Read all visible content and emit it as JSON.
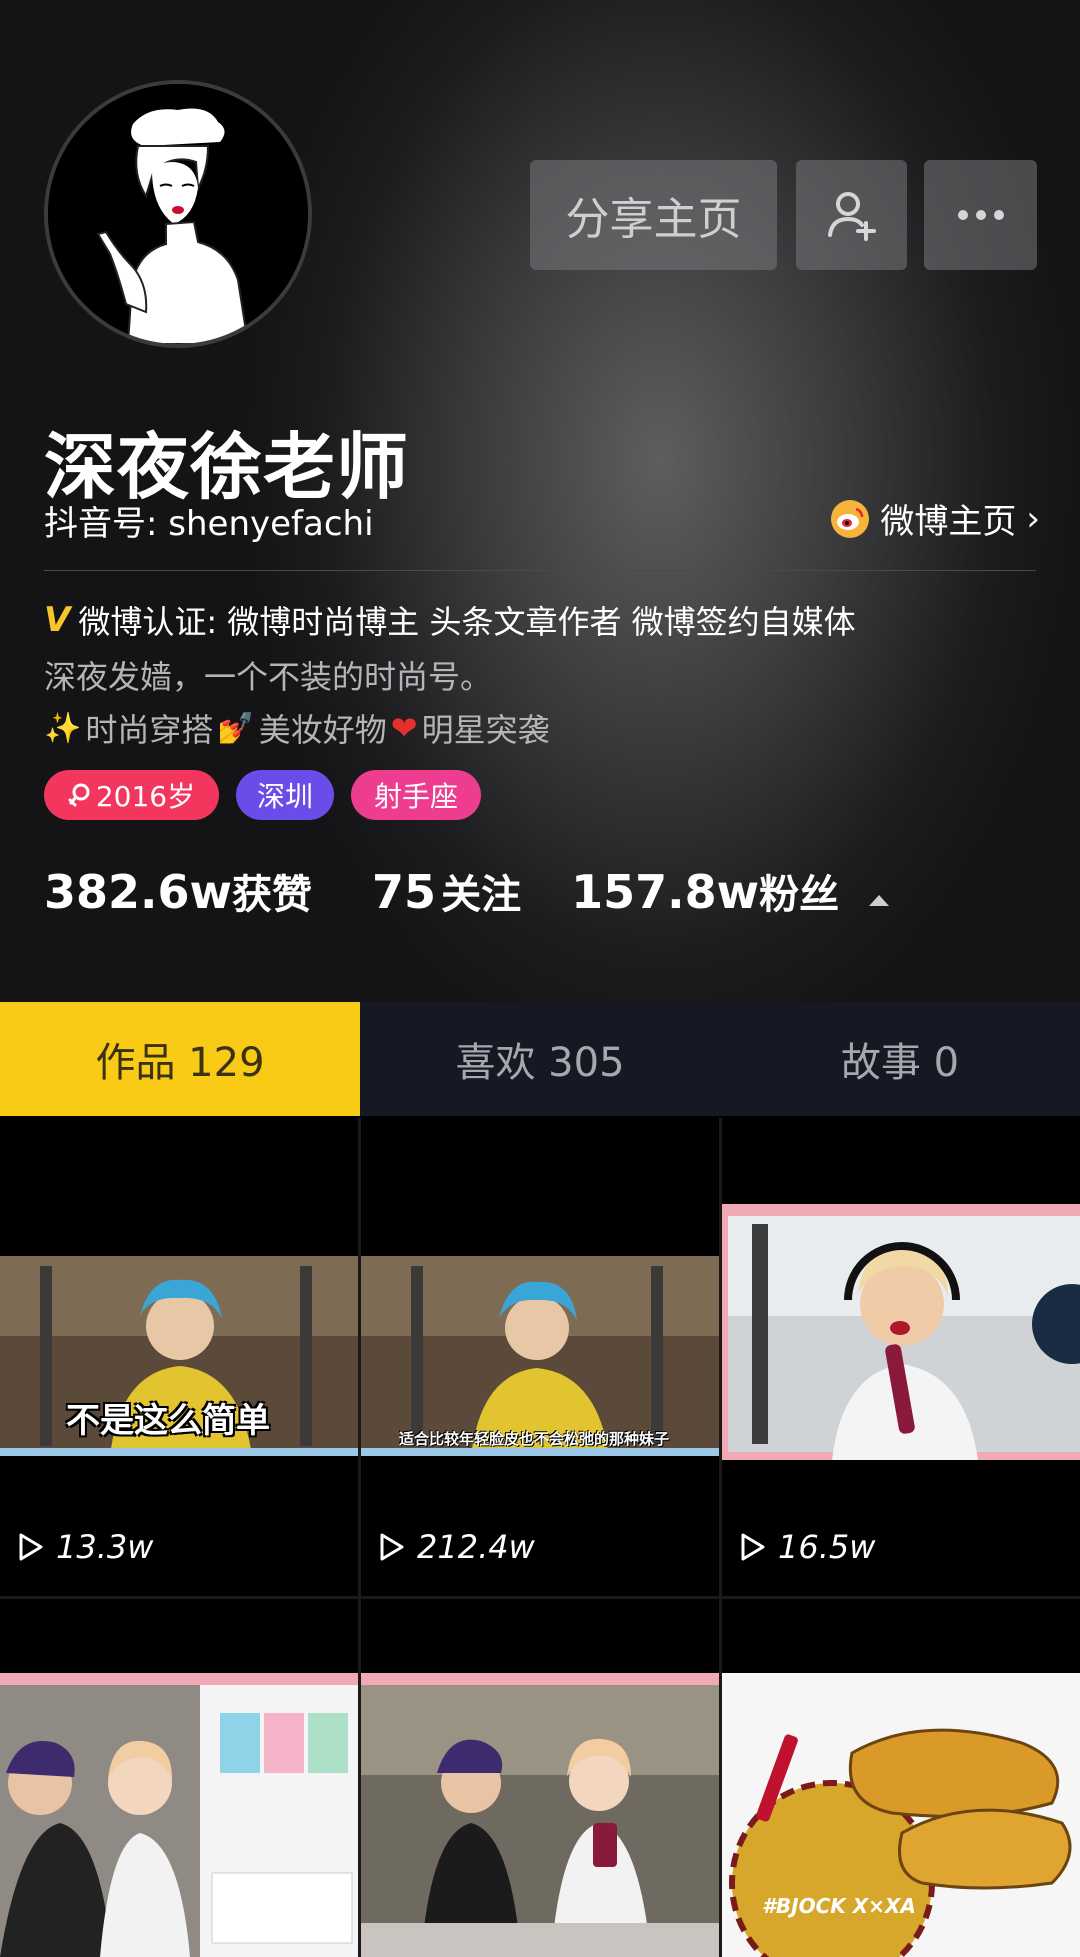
{
  "header": {
    "share_button": "分享主页",
    "add_friend_icon": "add-user-icon",
    "more_icon": "more-dots-icon"
  },
  "profile": {
    "name": "深夜徐老师",
    "douyin_id": "抖音号: shenyefachi",
    "weibo_link": "微博主页",
    "verification": "微博认证: 微博时尚博主 头条文章作者 微博签约自媒体",
    "bio_line1": "深夜发嫱，一个不装的时尚号。",
    "bio_line2_parts": [
      "时尚穿搭",
      "美妆好物",
      "明星突袭"
    ],
    "tags": [
      {
        "label": "2016岁",
        "color": "#f2365e"
      },
      {
        "label": "深圳",
        "color": "#6a4de8"
      },
      {
        "label": "射手座",
        "color": "#ee3d8f"
      }
    ]
  },
  "stats": {
    "likes_num": "382.6w",
    "likes_label": "获赞",
    "following_num": "75",
    "following_label": "关注",
    "fans_num": "157.8w",
    "fans_label": "粉丝"
  },
  "tabs": [
    {
      "label": "作品 129",
      "active": true
    },
    {
      "label": "喜欢 305",
      "active": false
    },
    {
      "label": "故事 0",
      "active": false
    }
  ],
  "videos": [
    {
      "views": "13.3w",
      "caption": "不是这么简单"
    },
    {
      "views": "212.4w",
      "caption": "适合比较年轻脸皮也不会松弛的那种妹子"
    },
    {
      "views": "16.5w",
      "caption": ""
    },
    {
      "views": "",
      "caption": ""
    },
    {
      "views": "",
      "caption": ""
    },
    {
      "views": "",
      "caption": ""
    }
  ],
  "colors": {
    "accent_yellow": "#f9cb16",
    "tab_bar": "#161824"
  }
}
